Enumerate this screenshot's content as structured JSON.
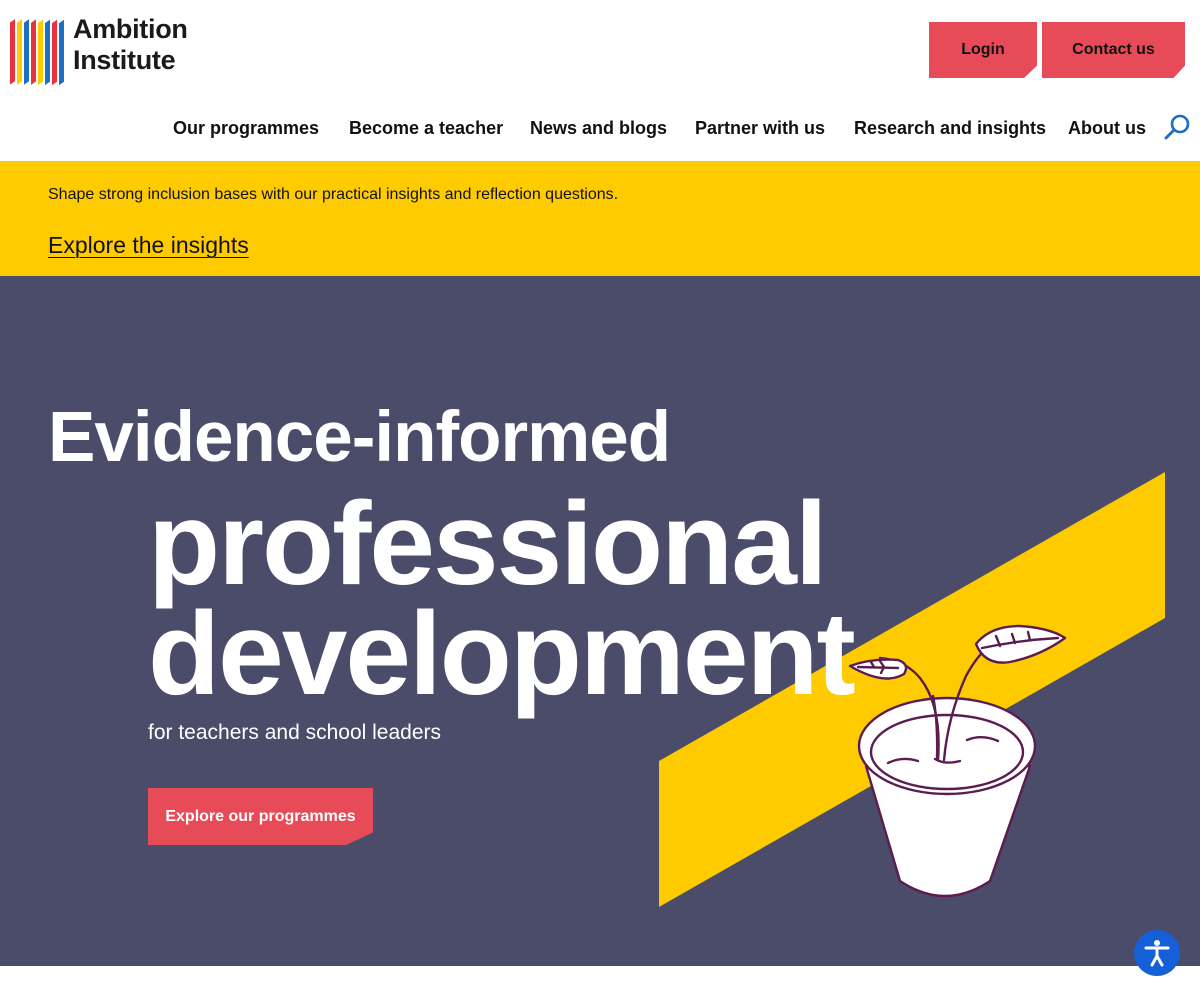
{
  "brand": {
    "line1": "Ambition",
    "line2": "Institute",
    "colors": {
      "red": "#e8323c",
      "blue": "#1c6fc4",
      "yellow": "#fecb00"
    }
  },
  "header": {
    "login_label": "Login",
    "contact_label": "Contact us",
    "button_color": "#e84b58"
  },
  "nav": {
    "items": [
      {
        "label": "Our programmes"
      },
      {
        "label": "Become a teacher"
      },
      {
        "label": "News and blogs"
      },
      {
        "label": "Partner with us"
      },
      {
        "label": "Research and insights"
      },
      {
        "label": "About us"
      }
    ],
    "search_icon": "search-icon"
  },
  "banner": {
    "text": "Shape strong inclusion bases with our practical insights and reflection questions.",
    "link": "Explore the insights",
    "background": "#fecb00"
  },
  "hero": {
    "headline_1": "Evidence-informed",
    "headline_2": "professional",
    "headline_3": "development",
    "subtitle": "for teachers and school leaders",
    "cta": "Explore our programmes",
    "background": "#4a4c69",
    "illustration": "plant-pot-icon"
  },
  "accessibility": {
    "icon": "accessibility-icon",
    "color": "#1560d8"
  }
}
